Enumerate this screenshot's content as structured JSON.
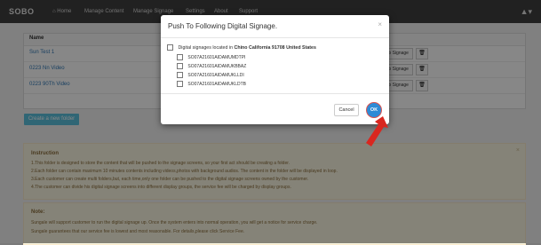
{
  "navbar": {
    "brand": "SOBO",
    "items": [
      "Home",
      "Manage Content",
      "Manage Signage",
      "Settings",
      "About",
      "Support"
    ],
    "user_icon": "user-icon"
  },
  "table": {
    "header": "Name",
    "rows": [
      {
        "name": "Sun Test 1",
        "signage_label": "to Signage"
      },
      {
        "name": "0223 Nn Video",
        "signage_label": "to Signage"
      },
      {
        "name": "0223 90Th Video",
        "signage_label": "to Signage"
      }
    ]
  },
  "create_button": "Create a new folder",
  "instruction": {
    "title": "Instruction",
    "lines": [
      "1.This folder is designed to store the content that will be pushed to the signage screens, so your first act should be creating a folder.",
      "2.Each folder can contain maximum 10 minutes contents including videos,photos with background audios. The content in the folder will be displayed in loop.",
      "3.Each customer can create multi folders,but, each time,only one folder can be pushed to the digital signage screens owned by the customer.",
      "4.The customer can divide his digital signage screens into different display groups, the service fee will be charged by display groups."
    ]
  },
  "note": {
    "title": "Note:",
    "lines": [
      "Sungale will support customer to run the digital signage up. Once the system enters into normal operation, you will get a notice for service charge.",
      "Sungale guarantees that our service fee is lowest and most reasonable. For details,please click Service Fee."
    ]
  },
  "modal": {
    "title": "Push To Following Digital Signage.",
    "close": "×",
    "location_prefix": "Digital signages located in",
    "location": "Chino California 91708 United States",
    "devices": [
      "SO07A21601AIDAMUMDTPI",
      "SO07A21601AIDAMUKBBAZ",
      "SO07A21601AIDAMUKLLDI",
      "SO07A21601AIDAMUKLDTB"
    ],
    "cancel_label": "Cancel",
    "ok_label": "OK"
  },
  "colors": {
    "accent": "#2e8bd6",
    "highlight": "#d9534f",
    "alert_bg": "#fcf8e3"
  }
}
